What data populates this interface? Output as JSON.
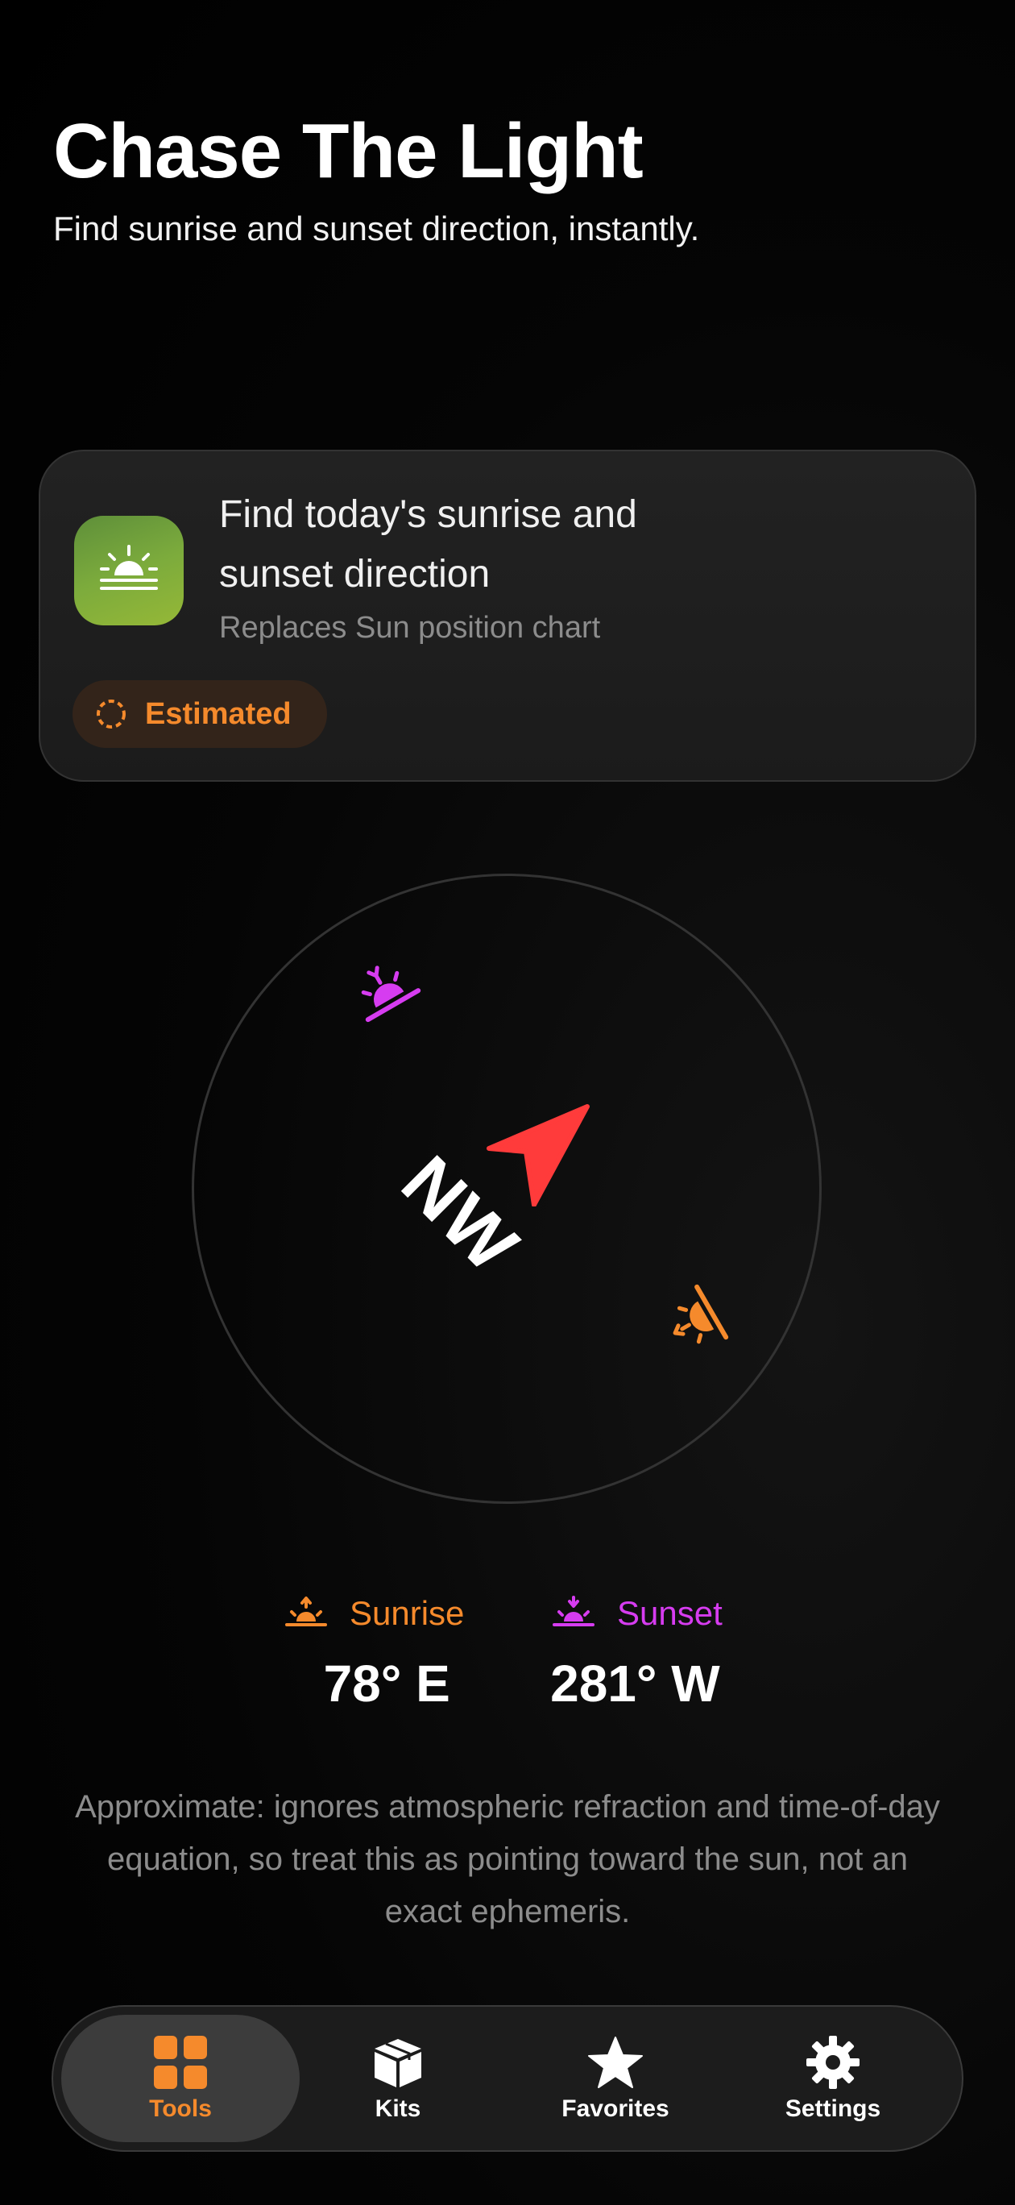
{
  "header": {
    "title": "Chase The Light",
    "subtitle": "Find sunrise and sunset direction, instantly."
  },
  "card": {
    "icon": "sunrise-icon",
    "title": "Find today's sunrise and sunset direction",
    "caption": "Replaces Sun position chart",
    "badge": {
      "icon": "dashed-circle-icon",
      "label": "Estimated",
      "color": "#f58a2c"
    }
  },
  "compass": {
    "heading": "NW",
    "pointer_color": "#ff3b3b",
    "sunrise_color": "#d63cf0",
    "sunset_color": "#f58a2c"
  },
  "readouts": {
    "sunrise": {
      "label": "Sunrise",
      "value": "78° E",
      "icon": "sunrise-icon",
      "color": "#f58a2c"
    },
    "sunset": {
      "label": "Sunset",
      "value": "281° W",
      "icon": "sunset-icon",
      "color": "#d63cf0"
    }
  },
  "disclaimer": "Approximate: ignores atmospheric refraction and time-of-day equation, so treat this as pointing toward the sun, not an exact ephemeris.",
  "tabbar": {
    "tabs": [
      {
        "label": "Tools",
        "icon": "grid-icon",
        "active": true
      },
      {
        "label": "Kits",
        "icon": "box-icon",
        "active": false
      },
      {
        "label": "Favorites",
        "icon": "star-icon",
        "active": false
      },
      {
        "label": "Settings",
        "icon": "gear-icon",
        "active": false
      }
    ],
    "accent": "#f58a2c"
  }
}
